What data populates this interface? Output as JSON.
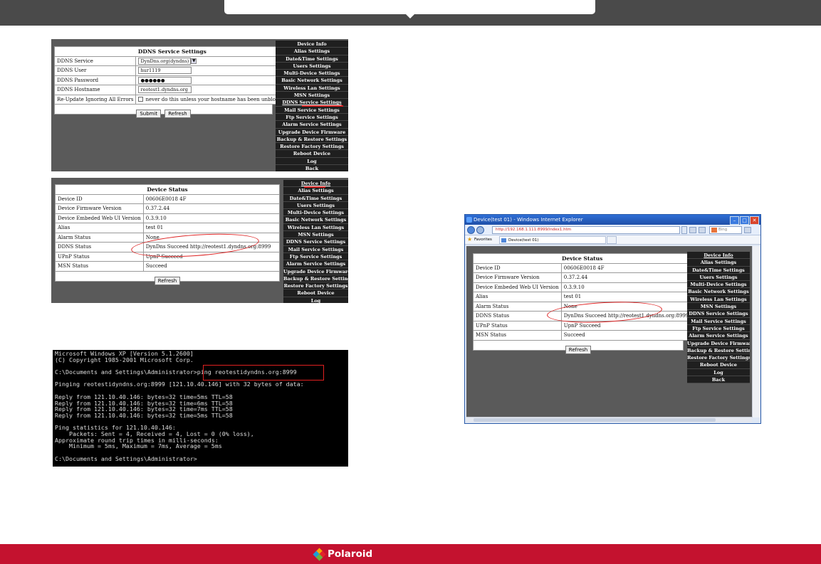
{
  "ddns_panel": {
    "header": "DDNS Service Settings",
    "rows": [
      {
        "label": "DDNS Service",
        "kind": "select",
        "value": "DynDns.org(dyndns)"
      },
      {
        "label": "DDNS User",
        "kind": "text",
        "value": "hur1119"
      },
      {
        "label": "DDNS Password",
        "kind": "password",
        "value": "●●●●●●"
      },
      {
        "label": "DDNS Hostname",
        "kind": "text",
        "value": "reotest1.dyndns.org"
      },
      {
        "label": "Re-Update Ignoring All Errors",
        "kind": "checkbox",
        "value": "never do this unless your hostname has been unblocked"
      }
    ],
    "submit_label": "Submit",
    "refresh_label": "Refresh",
    "selected_menu": "DDNS Service Settings"
  },
  "device_menu": [
    "Device Info",
    "Alias Settings",
    "Date&Time Settings",
    "Users Settings",
    "Multi-Device Settings",
    "Basic Network Settings",
    "Wireless Lan Settings",
    "MSN Settings",
    "DDNS Service Settings",
    "Mail Service Settings",
    "Ftp Service Settings",
    "Alarm Service Settings",
    "Upgrade Device Firmware",
    "Backup & Restore Settings",
    "Restore Factory Settings",
    "Reboot Device",
    "Log",
    "Back"
  ],
  "status_panel": {
    "header": "Device Status",
    "rows": [
      {
        "label": "Device ID",
        "value": "00606E0018 4F"
      },
      {
        "label": "Device Firmware Version",
        "value": "0.37.2.44"
      },
      {
        "label": "Device Embeded Web UI Version",
        "value": "0.3.9.10"
      },
      {
        "label": "Alias",
        "value": "test 01"
      },
      {
        "label": "Alarm Status",
        "value": "None"
      },
      {
        "label": "DDNS Status",
        "value": "DynDns Succeed http://reotest1.dyndns.org:8999"
      },
      {
        "label": "UPnP Status",
        "value": "UpnP Succeed"
      },
      {
        "label": "MSN Status",
        "value": "Succeed"
      }
    ],
    "refresh_label": "Refresh",
    "selected_menu": "Device Info"
  },
  "console": {
    "lines": [
      "Microsoft Windows XP [Version 5.1.2600]",
      "(C) Copyright 1985-2001 Microsoft Corp.",
      "",
      "C:\\Documents and Settings\\Administrator>ping reotestidyndns.org:8999",
      "",
      "Pinging reotestidyndns.org:8999 [121.10.40.146] with 32 bytes of data:",
      "",
      "Reply from 121.10.40.146: bytes=32 time=5ms TTL=58",
      "Reply from 121.10.40.146: bytes=32 time=6ms TTL=58",
      "Reply from 121.10.40.146: bytes=32 time=7ms TTL=58",
      "Reply from 121.10.40.146: bytes=32 time=5ms TTL=58",
      "",
      "Ping statistics for 121.10.40.146:",
      "    Packets: Sent = 4, Received = 4, Lost = 0 (0% loss),",
      "Approximate round trip times in milli-seconds:",
      "    Minimum = 5ms, Maximum = 7ms, Average = 5ms",
      "",
      "C:\\Documents and Settings\\Administrator>"
    ]
  },
  "browser": {
    "title": "Device(test 01) - Windows Internet Explorer",
    "url": "http://192.168.1.111:8999/index1.htm",
    "search_placeholder": "Bing",
    "favorites_label": "Favorites",
    "tab_label": "Device(test 01)"
  },
  "footer": {
    "brand": "Polaroid"
  },
  "colors": {
    "brand_red": "#c4122f",
    "highlight_red": "#d22222",
    "panel_gray": "#5a5a5a",
    "menu_black": "#1f1f1f"
  }
}
